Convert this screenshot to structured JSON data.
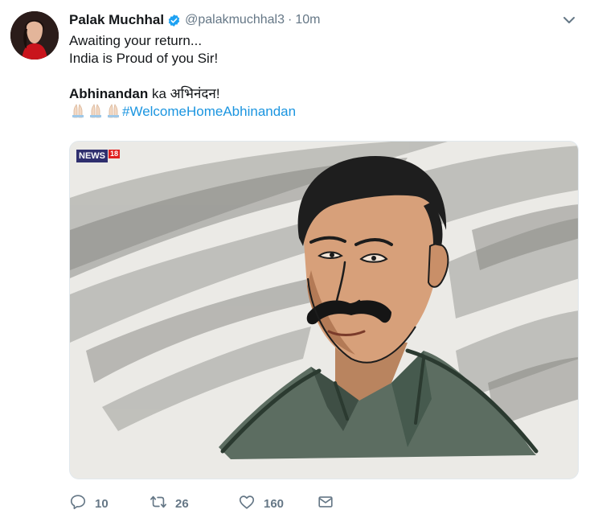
{
  "tweet": {
    "author_name": "Palak Muchhal",
    "handle": "@palakmuchhal3",
    "separator": "·",
    "time": "10m",
    "verified": true,
    "lines": {
      "line1": "Awaiting your return...",
      "line2": "India is Proud of you Sir!",
      "bold_word": "Abhinandan",
      "line4_rest": " ka अभिनंदन!",
      "hashtag": "#WelcomeHomeAbhinandan"
    },
    "emoji": [
      "folded-hands",
      "folded-hands",
      "folded-hands"
    ],
    "media": {
      "logo_text": "NEWS",
      "logo_number": "18"
    },
    "actions": {
      "replies": "10",
      "retweets": "26",
      "likes": "160"
    }
  },
  "colors": {
    "accent": "#1b95e0",
    "verified": "#1da1f2",
    "muted": "#657786",
    "text": "#14171a"
  },
  "icons": [
    "verified-badge-icon",
    "chevron-down-icon",
    "reply-icon",
    "retweet-icon",
    "like-icon",
    "direct-message-icon"
  ]
}
